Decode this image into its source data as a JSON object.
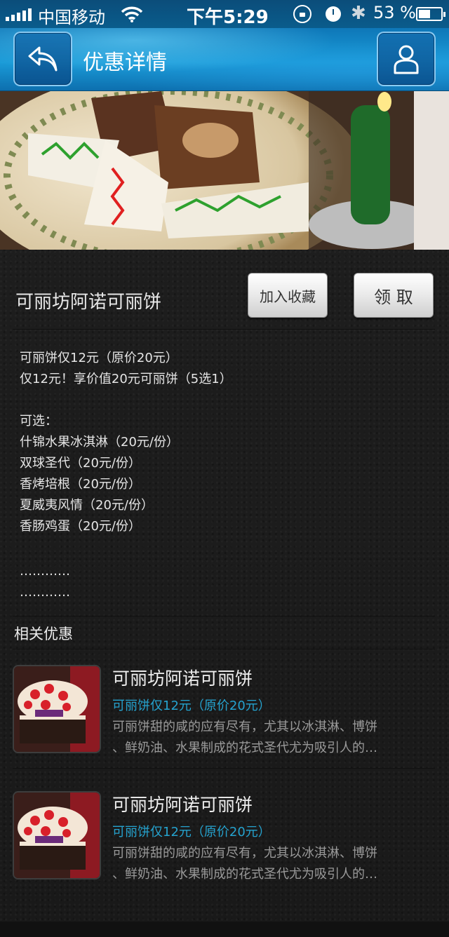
{
  "status_bar": {
    "carrier": "中国移动",
    "time": "下午5:29",
    "battery": "53 %"
  },
  "nav": {
    "title": "优惠详情",
    "back_icon": "back-arrow-icon",
    "user_icon": "user-icon"
  },
  "offer": {
    "title": "可丽坊阿诺可丽饼",
    "favorite_label": "加入收藏",
    "claim_label": "领 取",
    "description": [
      "可丽饼仅12元（原价20元）",
      "仅12元！享价值20元可丽饼（5选1）",
      "",
      "可选：",
      "什锦水果冰淇淋（20元/份）",
      "双球圣代（20元/份）",
      "香烤培根（20元/份）",
      "夏威夷风情（20元/份）",
      "香肠鸡蛋（20元/份）",
      "",
      "…………",
      "…………"
    ]
  },
  "related": {
    "title": "相关优惠",
    "items": [
      {
        "title": "可丽坊阿诺可丽饼",
        "subtitle": "可丽饼仅12元（原价20元）",
        "desc_line1": "可丽饼甜的咸的应有尽有，尤其以冰淇淋、博饼",
        "desc_line2": "、鲜奶油、水果制成的花式圣代尤为吸引人的…"
      },
      {
        "title": "可丽坊阿诺可丽饼",
        "subtitle": "可丽饼仅12元（原价20元）",
        "desc_line1": "可丽饼甜的咸的应有尽有，尤其以冰淇淋、博饼",
        "desc_line2": "、鲜奶油、水果制成的花式圣代尤为吸引人的…"
      }
    ]
  },
  "colors": {
    "accent": "#25a3cf",
    "nav_blue": "#1a9bd8",
    "background": "#1b1b1b"
  }
}
